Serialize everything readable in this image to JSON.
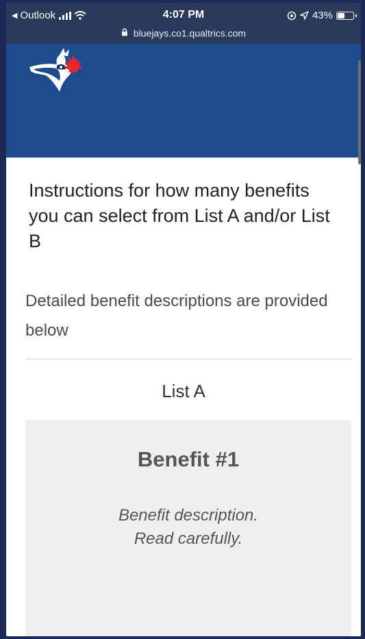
{
  "status_bar": {
    "back_app": "Outlook",
    "time": "4:07 PM",
    "battery": "43%",
    "url": "bluejays.co1.qualtrics.com"
  },
  "survey": {
    "instructions": "Instructions for how many benefits you can select from List A and/or List B",
    "detail_note": "Detailed benefit descriptions are provided below",
    "list_title": "List A",
    "benefit": {
      "title": "Benefit #1",
      "description_line1": "Benefit description.",
      "description_line2": "Read carefully."
    }
  },
  "colors": {
    "header": "#1e4a8e",
    "status_bar": "#2b3a5c",
    "card": "#efefef",
    "logo_leaf": "#e8242d"
  }
}
